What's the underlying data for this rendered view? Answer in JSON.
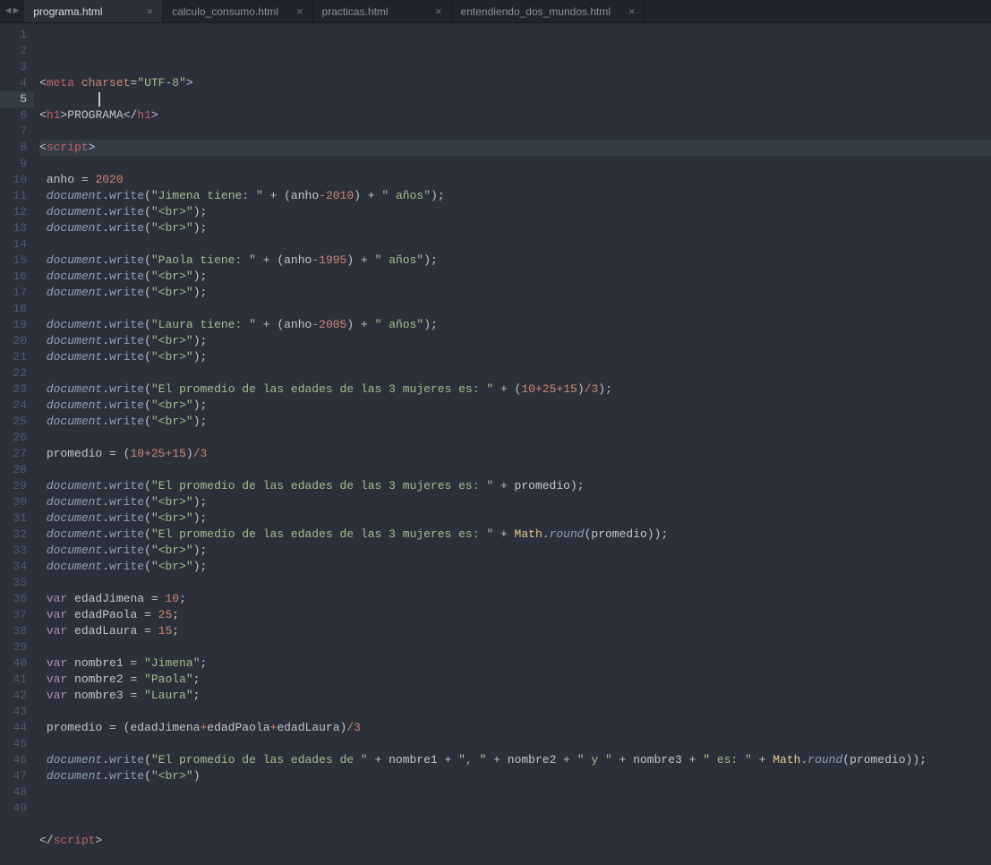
{
  "tabs": [
    {
      "label": "programa.html",
      "active": true
    },
    {
      "label": "calculo_consumo.html",
      "active": false
    },
    {
      "label": "practicas.html",
      "active": false
    },
    {
      "label": "entendiendo_dos_mundos.html",
      "active": false
    }
  ],
  "nav": {
    "left": "◄",
    "right": "►"
  },
  "active_line": 5,
  "total_lines": 49,
  "code_tokens": {
    "meta": "meta",
    "charset": "charset",
    "utf8": "\"UTF-8\"",
    "h1": "h1",
    "programa": "PROGRAMA",
    "script": "script",
    "anho": "anho",
    "eq": " = ",
    "n2020": "2020",
    "doc": "document",
    "write": "write",
    "jimena": "\"Jimena tiene: \"",
    "plus": " + ",
    "op": "(",
    "cp": ")",
    "minus": "-",
    "n2010": "2010",
    "anos": "\" años\"",
    "sc": ";",
    "br": "\"<br>\"",
    "paola": "\"Paola tiene: \"",
    "n1995": "1995",
    "laura": "\"Laura tiene: \"",
    "n2005": "2005",
    "prom1": "\"El promedio de las edades de las 3 mujeres es: \"",
    "n10": "10",
    "n25": "25",
    "n15": "15",
    "n3": "3",
    "slash": "/",
    "promedio": "promedio",
    "math": "Math",
    "round": "round",
    "var": "var",
    "edadJ": "edadJimena",
    "edadP": "edadPaola",
    "edadL": "edadLaura",
    "nom1": "nombre1",
    "nom2": "nombre2",
    "nom3": "nombre3",
    "sJim": "\"Jimena\"",
    "sPao": "\"Paola\"",
    "sLau": "\"Laura\"",
    "prom2": "\"El promedio de las edades de \"",
    "comma": "\", \"",
    "y": "\" y \"",
    "es": "\" es: \""
  }
}
